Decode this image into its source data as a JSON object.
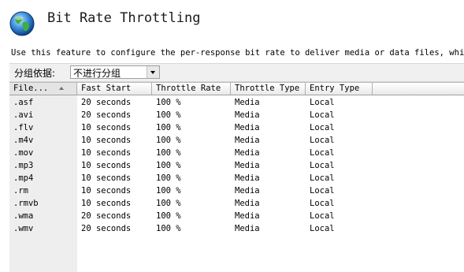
{
  "page": {
    "title": "Bit Rate Throttling",
    "description": "Use this feature to configure the per-response bit rate to deliver media or data files, which ca"
  },
  "groupby": {
    "label": "分组依据:",
    "selected": "不进行分组"
  },
  "table": {
    "columns": [
      "File...",
      "Fast Start",
      "Throttle Rate",
      "Throttle Type",
      "Entry Type"
    ],
    "sorted_column": 0,
    "rows": [
      [
        ".asf",
        "20 seconds",
        "100 %",
        "Media",
        "Local"
      ],
      [
        ".avi",
        "20 seconds",
        "100 %",
        "Media",
        "Local"
      ],
      [
        ".flv",
        "10 seconds",
        "100 %",
        "Media",
        "Local"
      ],
      [
        ".m4v",
        "10 seconds",
        "100 %",
        "Media",
        "Local"
      ],
      [
        ".mov",
        "10 seconds",
        "100 %",
        "Media",
        "Local"
      ],
      [
        ".mp3",
        "10 seconds",
        "100 %",
        "Media",
        "Local"
      ],
      [
        ".mp4",
        "10 seconds",
        "100 %",
        "Media",
        "Local"
      ],
      [
        ".rm",
        "10 seconds",
        "100 %",
        "Media",
        "Local"
      ],
      [
        ".rmvb",
        "10 seconds",
        "100 %",
        "Media",
        "Local"
      ],
      [
        ".wma",
        "20 seconds",
        "100 %",
        "Media",
        "Local"
      ],
      [
        ".wmv",
        "20 seconds",
        "100 %",
        "Media",
        "Local"
      ]
    ]
  },
  "icons": {
    "feature_icon": "globe-icon",
    "dropdown_icon": "chevron-down-icon",
    "sort_icon": "sort-ascending-icon"
  }
}
